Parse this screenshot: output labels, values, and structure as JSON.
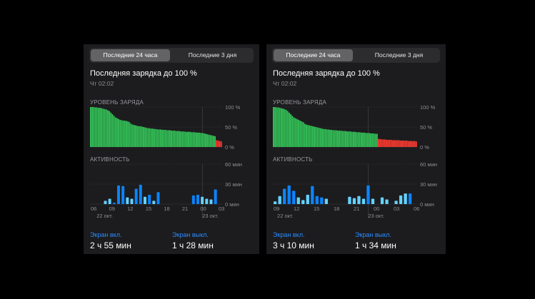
{
  "colors": {
    "background": "#000000",
    "panel": "#1c1c1e",
    "battery_fill": "#34c759",
    "battery_low": "#ff3b30",
    "activity_on": "#0a84ff",
    "activity_off": "#64d2ff",
    "stat_label": "#2a8cff"
  },
  "panels": [
    {
      "tabs": {
        "left": "Последние 24 часа",
        "right": "Последние 3 дня"
      },
      "title": "Последняя зарядка до 100 %",
      "subtitle": "Чт 02:02",
      "battery_label": "УРОВЕНЬ ЗАРЯДА",
      "battery_ticks": [
        "100 %",
        "50 %",
        "0 %"
      ],
      "activity_label": "АКТИВНОСТЬ",
      "activity_ticks": [
        "60 мин",
        "30 мин",
        "0 мин"
      ],
      "x_ticks": [
        "06",
        "09",
        "12",
        "15",
        "18",
        "21",
        "00",
        "03"
      ],
      "x_dates": [
        "22 окт.",
        "23 окт."
      ],
      "stats": {
        "screen_on_label": "Экран вкл.",
        "screen_on_value": "2 ч 55 мин",
        "screen_off_label": "Экран выкл.",
        "screen_off_value": "1 ч 28 мин"
      },
      "chart_data": [
        {
          "type": "bar",
          "title": "УРОВЕНЬ ЗАРЯДА",
          "ylim": [
            0,
            100
          ],
          "unit": "%",
          "low_threshold": 20,
          "values": [
            100,
            100,
            100,
            99,
            99,
            98,
            98,
            97,
            96,
            95,
            94,
            92,
            90,
            86,
            82,
            78,
            74,
            72,
            70,
            68,
            67,
            66,
            66,
            65,
            64,
            62,
            58,
            56,
            55,
            54,
            53,
            52,
            52,
            51,
            50,
            49,
            48,
            47,
            47,
            46,
            46,
            45,
            45,
            44,
            44,
            44,
            43,
            43,
            43,
            42,
            42,
            42,
            41,
            41,
            41,
            40,
            40,
            40,
            39,
            39,
            39,
            38,
            38,
            38,
            38,
            37,
            37,
            37,
            36,
            36,
            36,
            35,
            35,
            34,
            33,
            32,
            31,
            30,
            29,
            28,
            27,
            17,
            16,
            15,
            14
          ]
        },
        {
          "type": "bar",
          "title": "АКТИВНОСТЬ",
          "ylim": [
            0,
            60
          ],
          "unit": "мин",
          "series": [
            {
              "name": "Экран вкл.",
              "values": [
                0,
                0,
                0,
                0,
                0,
                2,
                28,
                27,
                0,
                0,
                23,
                29,
                0,
                14,
                0,
                18,
                0,
                0,
                0,
                0,
                0,
                0,
                0,
                13,
                14,
                0,
                0,
                0,
                22,
                0
              ]
            },
            {
              "name": "Экран выкл.",
              "values": [
                0,
                0,
                0,
                5,
                8,
                3,
                0,
                0,
                10,
                8,
                0,
                0,
                11,
                0,
                5,
                0,
                0,
                0,
                0,
                0,
                0,
                0,
                0,
                0,
                0,
                11,
                8,
                7,
                0,
                0
              ]
            }
          ]
        }
      ]
    },
    {
      "tabs": {
        "left": "Последние 24 часа",
        "right": "Последние 3 дня"
      },
      "title": "Последняя зарядка до 100 %",
      "subtitle": "Чт 02:02",
      "battery_label": "УРОВЕНЬ ЗАРЯДА",
      "battery_ticks": [
        "100 %",
        "50 %",
        "0 %"
      ],
      "activity_label": "АКТИВНОСТЬ",
      "activity_ticks": [
        "60 мин",
        "30 мин",
        "0 мин"
      ],
      "x_ticks": [
        "09",
        "12",
        "15",
        "18",
        "21",
        "00",
        "03",
        "06"
      ],
      "x_dates": [
        "22 окт.",
        "23 окт."
      ],
      "stats": {
        "screen_on_label": "Экран вкл.",
        "screen_on_value": "3 ч 10 мин",
        "screen_off_label": "Экран выкл.",
        "screen_off_value": "1 ч 34 мин"
      },
      "chart_data": [
        {
          "type": "bar",
          "title": "УРОВЕНЬ ЗАРЯДА",
          "ylim": [
            0,
            100
          ],
          "unit": "%",
          "low_threshold": 20,
          "values": [
            100,
            100,
            99,
            99,
            98,
            97,
            96,
            95,
            93,
            90,
            86,
            82,
            78,
            74,
            72,
            70,
            68,
            66,
            64,
            62,
            58,
            56,
            55,
            54,
            53,
            52,
            51,
            50,
            49,
            48,
            47,
            46,
            45,
            45,
            44,
            44,
            43,
            43,
            42,
            42,
            42,
            41,
            41,
            41,
            40,
            40,
            40,
            39,
            39,
            39,
            38,
            38,
            38,
            37,
            37,
            37,
            36,
            36,
            36,
            35,
            35,
            35,
            34,
            34,
            34,
            33,
            33,
            20,
            20,
            19,
            19,
            19,
            18,
            18,
            18,
            18,
            17,
            17,
            17,
            17,
            17,
            16,
            16,
            16,
            16,
            16,
            15,
            15,
            15,
            15,
            15,
            14
          ]
        },
        {
          "type": "bar",
          "title": "АКТИВНОСТЬ",
          "ylim": [
            0,
            60
          ],
          "unit": "мин",
          "series": [
            {
              "name": "Экран вкл.",
              "values": [
                0,
                0,
                23,
                28,
                20,
                0,
                0,
                0,
                27,
                12,
                10,
                0,
                0,
                0,
                0,
                0,
                0,
                0,
                0,
                0,
                28,
                0,
                0,
                0,
                0,
                0,
                0,
                0,
                0,
                16,
                0
              ]
            },
            {
              "name": "Экран выкл.",
              "values": [
                4,
                12,
                0,
                0,
                0,
                10,
                6,
                14,
                0,
                0,
                0,
                8,
                0,
                0,
                0,
                0,
                11,
                9,
                12,
                8,
                0,
                8,
                0,
                10,
                7,
                0,
                5,
                13,
                16,
                0,
                0
              ]
            }
          ]
        }
      ]
    }
  ]
}
